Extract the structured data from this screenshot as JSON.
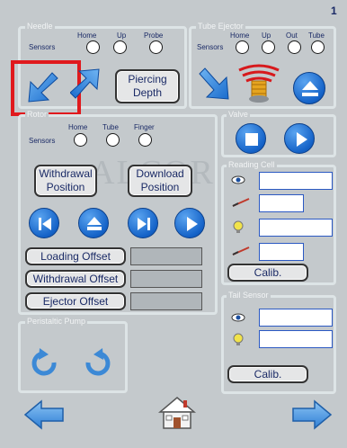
{
  "page_number": "1",
  "needle": {
    "title": "Needle",
    "sensors_label": "Sensors",
    "sensor_names": [
      "Home",
      "Up",
      "Probe"
    ],
    "piercing_depth_line1": "Piercing",
    "piercing_depth_line2": "Depth"
  },
  "tube_ejector": {
    "title": "Tube Ejector",
    "sensors_label": "Sensors",
    "sensor_names": [
      "Home",
      "Up",
      "Out",
      "Tube"
    ]
  },
  "rotor": {
    "title": "Rotor",
    "sensors_label": "Sensors",
    "sensor_names": [
      "Home",
      "Tube",
      "Finger"
    ],
    "withdrawal_position_line1": "Withdrawal",
    "withdrawal_position_line2": "Position",
    "download_position_line1": "Download",
    "download_position_line2": "Position",
    "loading_offset": "Loading Offset",
    "withdrawal_offset": "Withdrawal Offset",
    "ejector_offset": "Ejector Offset"
  },
  "valve": {
    "title": "Valve"
  },
  "reading_cell": {
    "title": "Reading Cell",
    "calib": "Calib."
  },
  "tail_sensor": {
    "title": "Tail Sensor",
    "calib": "Calib."
  },
  "peristaltic_pump": {
    "title": "Peristaltic Pump"
  },
  "watermark": "ALCOR",
  "colors": {
    "background": "#c4c9cc",
    "accent_blue": "#1563c8",
    "highlight_red": "#e0191d",
    "label_navy": "#1a2a66"
  },
  "icons": {
    "needle_down_left": "arrow-down-left-icon",
    "needle_up_right": "arrow-up-right-icon",
    "ejector_diagonal": "arrow-down-right-icon",
    "ejector_spring": "spring-solenoid-icon",
    "eject": "eject-icon",
    "stop": "stop-icon",
    "play": "play-icon",
    "skip_first": "skip-to-start-icon",
    "skip_next": "skip-next-icon",
    "rotate_ccw": "rotate-ccw-icon",
    "rotate_cw": "rotate-cw-icon",
    "back": "back-arrow-icon",
    "forward": "forward-arrow-icon",
    "home": "home-icon",
    "eye": "eye-icon",
    "pen": "pen-icon",
    "bulb": "light-bulb-icon"
  }
}
